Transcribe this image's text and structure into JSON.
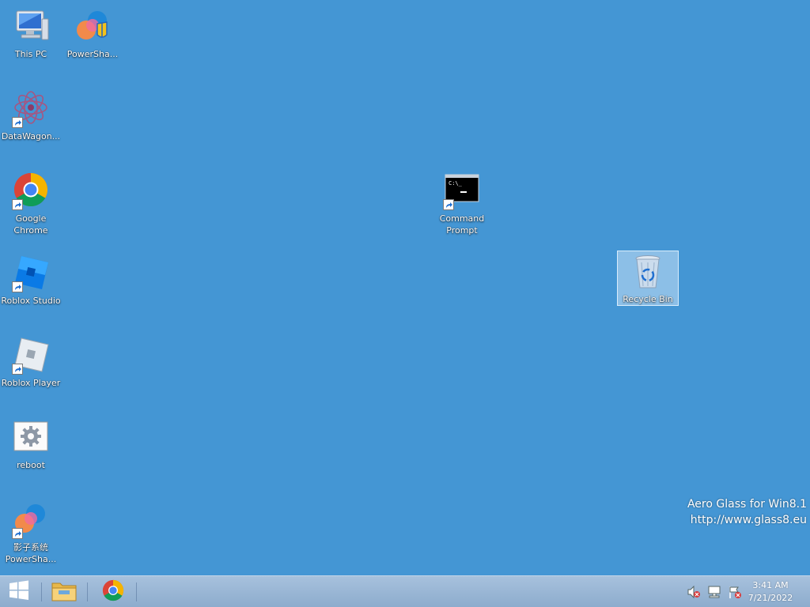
{
  "desktop": {
    "background_color": "#4496d4",
    "icons": [
      {
        "label": "This PC",
        "icon": "this-pc-icon"
      },
      {
        "label": "PowerSha...",
        "icon": "powershell-icon"
      },
      {
        "label": "DataWagon...",
        "icon": "datawagon-icon"
      },
      {
        "label": "Google Chrome",
        "icon": "chrome-icon"
      },
      {
        "label": "Roblox Studio",
        "icon": "roblox-studio-icon"
      },
      {
        "label": "Roblox Player",
        "icon": "roblox-player-icon"
      },
      {
        "label": "reboot",
        "icon": "settings-gear-icon"
      },
      {
        "label": "影子系统 PowerSha...",
        "icon": "powershell-icon"
      },
      {
        "label": "Command Prompt",
        "icon": "command-prompt-icon"
      },
      {
        "label": "Recycle Bin",
        "icon": "recycle-bin-icon"
      }
    ]
  },
  "watermark": {
    "line1": "Aero Glass for Win8.1",
    "line2": "http://www.glass8.eu"
  },
  "taskbar": {
    "start_icon": "windows-logo-icon",
    "pinned": [
      "file-explorer-icon",
      "chrome-icon"
    ],
    "tray_icons": [
      "volume-muted-icon",
      "network-icon",
      "action-center-flag-icon"
    ],
    "time": "3:41 AM",
    "date": "7/21/2022"
  }
}
